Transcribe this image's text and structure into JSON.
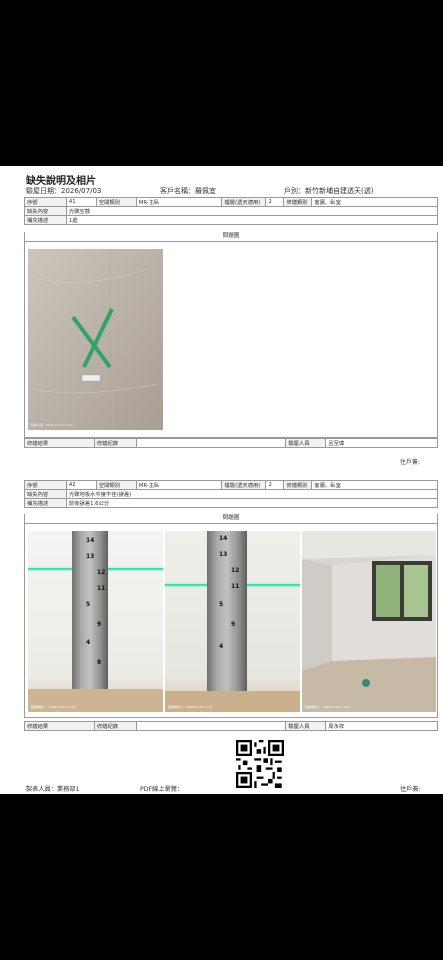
{
  "header": {
    "title": "缺失說明及相片",
    "inspection_date": "驗屋日期：2026/07/03",
    "customer": "客戶名稱：羅佩宜",
    "unit": "戶別：新竹新埔自建透天(透)"
  },
  "labels": {
    "seq": "序號",
    "space": "空間類別",
    "floor": "樓層(透天適用)",
    "location": "修繕類別",
    "content": "缺失內容",
    "note": "補充描述",
    "photos": "問題圖",
    "repair_result": "修繕結果",
    "repair_record": "修繕紀錄",
    "inspector": "驗屋人員"
  },
  "records": [
    {
      "seq": "41",
      "space": "MR-主臥",
      "floor": "2",
      "location": "客廳、臥室",
      "content": "光碟空鼓",
      "note": "1處",
      "inspector": "呂至璋",
      "signature": "住戶簽:",
      "photo_stamps": [
        "驗屋日期 : 2026-07-03 13:00"
      ]
    },
    {
      "seq": "42",
      "space": "MR-主臥",
      "floor": "2",
      "location": "客廳、臥室",
      "content": "光碟地板水平度不佳(誤差)",
      "note": "前後誤差1.6公分",
      "inspector": "周永祥",
      "photo_stamps": [
        "驗屋證據 1 : 2026-07-03 11:41",
        "驗屋證據 2 : 2026-07-03 11:41",
        "驗屋證據 3 : 2026-07-03 11:42"
      ],
      "ruler_numbers_1": [
        "14",
        "13",
        "12",
        "11",
        "5",
        "9",
        "4",
        "8"
      ],
      "ruler_numbers_2": [
        "14",
        "13",
        "12",
        "11",
        "5",
        "9",
        "4"
      ]
    }
  ],
  "footer": {
    "maker": "製表人員：業務部1",
    "pdf": "PDF線上瀏覽：",
    "signature": "住戶簽:"
  }
}
